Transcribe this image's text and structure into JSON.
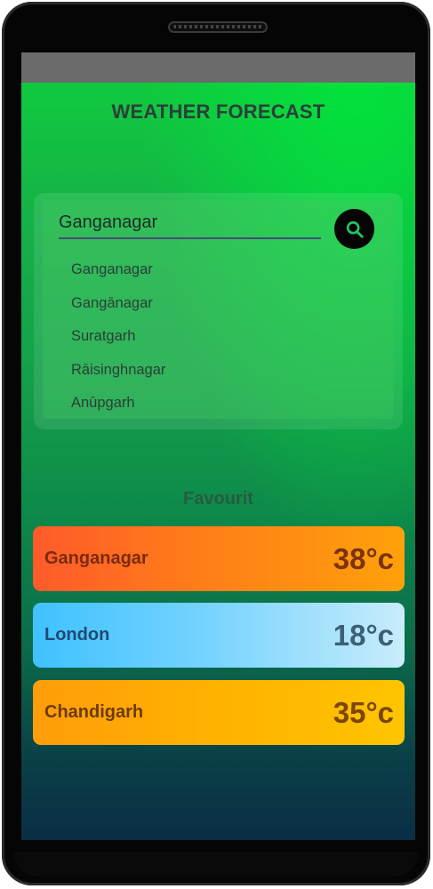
{
  "app": {
    "title": "WEATHER FORECAST"
  },
  "search": {
    "value": "Ganganagar",
    "suggestions": [
      "Ganganagar",
      "Gangānagar",
      "Suratgarh",
      "Rāisinghnagar",
      "Anūpgarh"
    ]
  },
  "favourites": {
    "title": "Favourit",
    "items": [
      {
        "city": "Ganganagar",
        "temp": "38°c"
      },
      {
        "city": "London",
        "temp": "18°c"
      },
      {
        "city": "Chandigarh",
        "temp": "35°c"
      }
    ]
  },
  "icons": {
    "search_button": "search-icon"
  }
}
